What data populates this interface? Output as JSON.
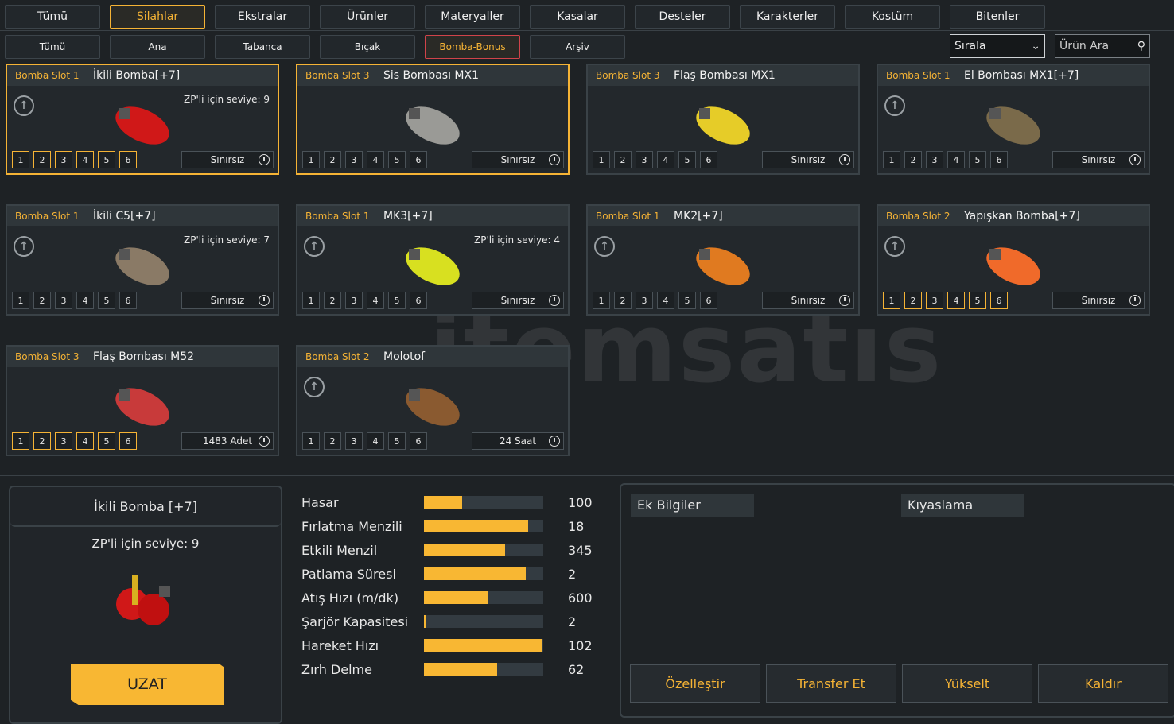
{
  "top_tabs": [
    "Tümü",
    "Silahlar",
    "Ekstralar",
    "Ürünler",
    "Materyaller",
    "Kasalar",
    "Desteler",
    "Karakterler",
    "Kostüm",
    "Bitenler"
  ],
  "sub_tabs": [
    "Tümü",
    "Ana",
    "Tabanca",
    "Bıçak",
    "Bomba-Bonus",
    "Arşiv"
  ],
  "sort_label": "Sırala",
  "search_placeholder": "Ürün Ara",
  "watermark": "itemsatıs",
  "cards": [
    {
      "slot": "Bomba Slot 1",
      "name": "İkili Bomba[+7]",
      "zp": "ZP'li için seviye: 9",
      "duration": "Sınırsız",
      "color": "#d01818"
    },
    {
      "slot": "Bomba Slot 3",
      "name": "Sis Bombası MX1",
      "zp": "",
      "duration": "Sınırsız",
      "color": "#9a9a96"
    },
    {
      "slot": "Bomba Slot 3",
      "name": "Flaş Bombası MX1",
      "zp": "",
      "duration": "Sınırsız",
      "color": "#e6cc28"
    },
    {
      "slot": "Bomba Slot 1",
      "name": "El Bombası MX1[+7]",
      "zp": "",
      "duration": "Sınırsız",
      "color": "#7a6a4a"
    },
    {
      "slot": "Bomba Slot 1",
      "name": "İkili C5[+7]",
      "zp": "ZP'li için seviye: 7",
      "duration": "Sınırsız",
      "color": "#8a7a66"
    },
    {
      "slot": "Bomba Slot 1",
      "name": "MK3[+7]",
      "zp": "ZP'li için seviye: 4",
      "duration": "Sınırsız",
      "color": "#d8e020"
    },
    {
      "slot": "Bomba Slot 1",
      "name": "MK2[+7]",
      "zp": "",
      "duration": "Sınırsız",
      "color": "#e07a20"
    },
    {
      "slot": "Bomba Slot 2",
      "name": "Yapışkan Bomba[+7]",
      "zp": "",
      "duration": "Sınırsız",
      "color": "#f06a2a"
    },
    {
      "slot": "Bomba Slot 3",
      "name": "Flaş Bombası M52",
      "zp": "",
      "duration": "1483 Adet",
      "color": "#c83a3a"
    },
    {
      "slot": "Bomba Slot 2",
      "name": "Molotof",
      "zp": "",
      "duration": "24 Saat",
      "color": "#8a5a30"
    }
  ],
  "slot_numbers": [
    "1",
    "2",
    "3",
    "4",
    "5",
    "6"
  ],
  "detail": {
    "title": "İkili Bomba [+7]",
    "zp": "ZP'li için seviye: 9",
    "button": "UZAT"
  },
  "stats": [
    {
      "label": "Hasar",
      "value": "100",
      "fill": 0.32
    },
    {
      "label": "Fırlatma Menzili",
      "value": "18",
      "fill": 0.87
    },
    {
      "label": "Etkili Menzil",
      "value": "345",
      "fill": 0.68
    },
    {
      "label": "Patlama Süresi",
      "value": "2",
      "fill": 0.85
    },
    {
      "label": "Atış Hızı (m/dk)",
      "value": "600",
      "fill": 0.53
    },
    {
      "label": "Şarjör Kapasitesi",
      "value": "2",
      "fill": 0.01
    },
    {
      "label": "Hareket Hızı",
      "value": "102",
      "fill": 0.99
    },
    {
      "label": "Zırh Delme",
      "value": "62",
      "fill": 0.61
    }
  ],
  "info": {
    "extra": "Ek Bilgiler",
    "compare": "Kıyaslama"
  },
  "actions": [
    "Özelleştir",
    "Transfer Et",
    "Yükselt",
    "Kaldır"
  ]
}
